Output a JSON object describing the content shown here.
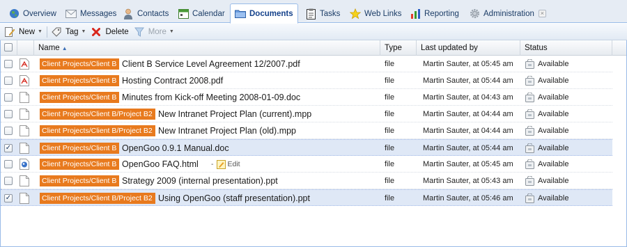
{
  "tabs": [
    {
      "label": "Overview",
      "icon": "globe-icon"
    },
    {
      "label": "Messages",
      "icon": "envelope-icon"
    },
    {
      "label": "Contacts",
      "icon": "person-icon"
    },
    {
      "label": "Calendar",
      "icon": "calendar-icon"
    },
    {
      "label": "Documents",
      "icon": "folder-icon",
      "active": true
    },
    {
      "label": "Tasks",
      "icon": "clipboard-icon"
    },
    {
      "label": "Web Links",
      "icon": "star-icon"
    },
    {
      "label": "Reporting",
      "icon": "bar-chart-icon"
    },
    {
      "label": "Administration",
      "icon": "gear-icon"
    }
  ],
  "toolbar": {
    "new_label": "New",
    "tag_label": "Tag",
    "delete_label": "Delete",
    "more_label": "More"
  },
  "columns": {
    "name": "Name",
    "type": "Type",
    "updated": "Last updated by",
    "status": "Status"
  },
  "rows": [
    {
      "checked": false,
      "icon": "pdf-file-icon",
      "workspace": "Client Projects/Client B",
      "name": "Client B Service Level Agreement 12/2007.pdf",
      "type": "file",
      "updated": "Martin Sauter, at 05:45 am",
      "status": "Available"
    },
    {
      "checked": false,
      "icon": "pdf-file-icon",
      "workspace": "Client Projects/Client B",
      "name": "Hosting Contract 2008.pdf",
      "type": "file",
      "updated": "Martin Sauter, at 05:44 am",
      "status": "Available"
    },
    {
      "checked": false,
      "icon": "document-file-icon",
      "workspace": "Client Projects/Client B",
      "name": "Minutes from Kick-off Meeting 2008-01-09.doc",
      "type": "file",
      "updated": "Martin Sauter, at 04:43 am",
      "status": "Available"
    },
    {
      "checked": false,
      "icon": "document-file-icon",
      "workspace": "Client Projects/Client B/Project B2",
      "name": "New Intranet Project Plan (current).mpp",
      "type": "file",
      "updated": "Martin Sauter, at 04:44 am",
      "status": "Available"
    },
    {
      "checked": false,
      "icon": "document-file-icon",
      "workspace": "Client Projects/Client B/Project B2",
      "name": "New Intranet Project Plan (old).mpp",
      "type": "file",
      "updated": "Martin Sauter, at 04:44 am",
      "status": "Available"
    },
    {
      "checked": true,
      "icon": "document-file-icon",
      "workspace": "Client Projects/Client B",
      "name": "OpenGoo 0.9.1 Manual.doc",
      "type": "file",
      "updated": "Martin Sauter, at 05:44 am",
      "status": "Available"
    },
    {
      "checked": false,
      "icon": "html-file-icon",
      "workspace": "Client Projects/Client B",
      "name": "OpenGoo FAQ.html",
      "type": "file",
      "updated": "Martin Sauter, at 05:45 am",
      "status": "Available",
      "edit": "Edit"
    },
    {
      "checked": false,
      "icon": "document-file-icon",
      "workspace": "Client Projects/Client B",
      "name": "Strategy 2009 (internal presentation).ppt",
      "type": "file",
      "updated": "Martin Sauter, at 05:43 am",
      "status": "Available"
    },
    {
      "checked": true,
      "icon": "document-file-icon",
      "workspace": "Client Projects/Client B/Project B2",
      "name": "Using OpenGoo (staff presentation).ppt",
      "type": "file",
      "updated": "Martin Sauter, at 05:46 am",
      "status": "Available"
    }
  ]
}
